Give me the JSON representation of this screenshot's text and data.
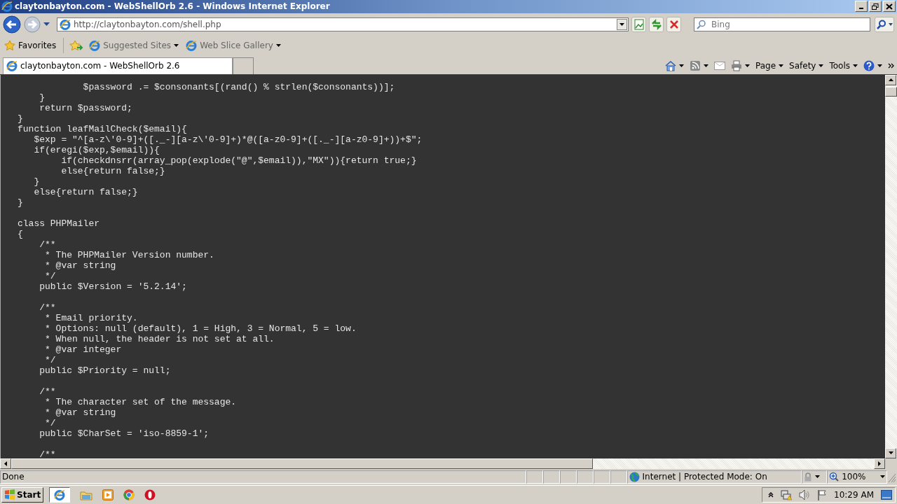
{
  "window": {
    "title": "claytonbayton.com - WebShellOrb 2.6 - Windows Internet Explorer"
  },
  "address_bar": {
    "url": "http://claytonbayton.com/shell.php"
  },
  "search": {
    "placeholder": "Bing"
  },
  "favorites_bar": {
    "favorites": "Favorites",
    "links": [
      "Suggested Sites",
      "Web Slice Gallery"
    ]
  },
  "tabs": [
    {
      "label": "claytonbayton.com - WebShellOrb 2.6",
      "selected": true
    }
  ],
  "command_bar": [
    "Page",
    "Safety",
    "Tools"
  ],
  "code": {
    "blocks": [
      [
        "            $password .= $consonants[(rand() % strlen($consonants))];",
        "    }",
        "    return $password;",
        "}",
        "function leafMailCheck($email){",
        "   $exp = \"^[a-z\\'0-9]+([._-][a-z\\'0-9]+)*@([a-z0-9]+([._-][a-z0-9]+))+$\";",
        "   if(eregi($exp,$email)){",
        "        if(checkdnsrr(array_pop(explode(\"@\",$email)),\"MX\")){return true;}",
        "        else{return false;}",
        "   }",
        "   else{return false;}",
        "}"
      ],
      [
        "class PHPMailer",
        "{",
        "    /**",
        "     * The PHPMailer Version number.",
        "     * @var string",
        "     */",
        "    public $Version = '5.2.14';"
      ],
      [
        "    /**",
        "     * Email priority.",
        "     * Options: null (default), 1 = High, 3 = Normal, 5 = low.",
        "     * When null, the header is not set at all.",
        "     * @var integer",
        "     */",
        "    public $Priority = null;"
      ],
      [
        "    /**",
        "     * The character set of the message.",
        "     * @var string",
        "     */",
        "    public $CharSet = 'iso-8859-1';"
      ],
      [
        "    /**"
      ]
    ]
  },
  "status_bar": {
    "status": "Done",
    "zone": "Internet | Protected Mode: On",
    "zoom": "100%"
  },
  "taskbar": {
    "start": "Start",
    "clock": "10:29 AM"
  }
}
